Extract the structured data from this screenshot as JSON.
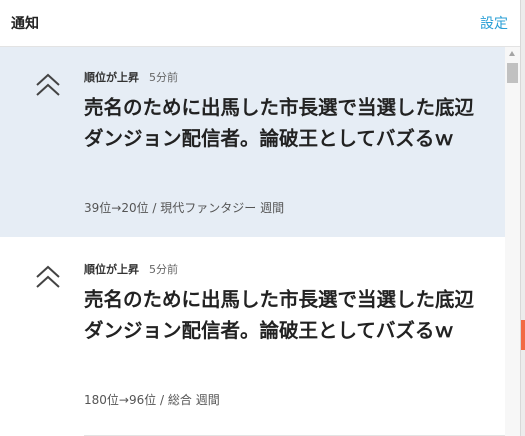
{
  "header": {
    "title": "通知",
    "settings_label": "設定"
  },
  "notifications": [
    {
      "icon": "double-chevron-up-icon",
      "type": "順位が上昇",
      "time": "5分前",
      "title": "売名のために出馬した市長選で当選した底辺ダンジョン配信者。論破王としてバズるｗ",
      "detail": "39位→20位 / 現代ファンタジー 週間",
      "unread": true
    },
    {
      "icon": "double-chevron-up-icon",
      "type": "順位が上昇",
      "time": "5分前",
      "title": "売名のために出馬した市長選で当選した底辺ダンジョン配信者。論破王としてバズるｗ",
      "detail": "180位→96位 / 総合 週間",
      "unread": false
    }
  ],
  "colors": {
    "unread_bg": "#e6edf5",
    "link": "#2a9fd6"
  }
}
